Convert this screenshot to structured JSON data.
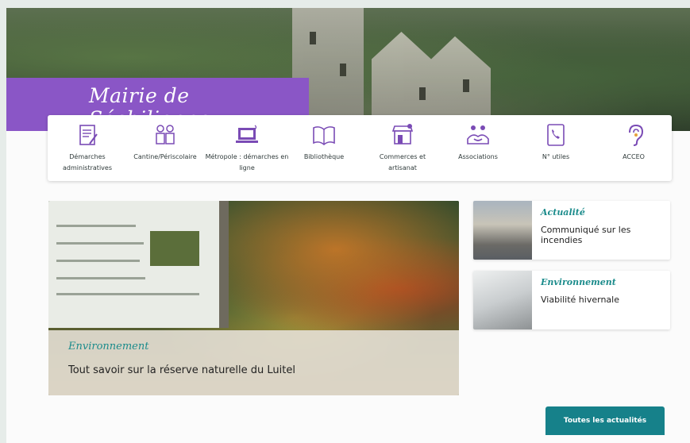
{
  "site": {
    "title": "Mairie de Séchilienne"
  },
  "quick_links": [
    {
      "label": "Démarches administratives",
      "icon": "document-icon"
    },
    {
      "label": "Cantine/Périscolaire",
      "icon": "children-icon"
    },
    {
      "label": "Métropole : démarches en ligne",
      "icon": "laptop-icon"
    },
    {
      "label": "Bibliothèque",
      "icon": "book-icon"
    },
    {
      "label": "Commerces et artisanat",
      "icon": "shop-icon"
    },
    {
      "label": "Associations",
      "icon": "handshake-icon"
    },
    {
      "label": "N° utiles",
      "icon": "phone-icon"
    },
    {
      "label": "ACCEO",
      "icon": "ear-icon"
    }
  ],
  "featured": {
    "category": "Environnement",
    "title": "Tout savoir sur la réserve naturelle du Luitel"
  },
  "news": [
    {
      "category": "Actualité",
      "title": "Communiqué sur les incendies"
    },
    {
      "category": "Environnement",
      "title": "Viabilité hivernale"
    }
  ],
  "actions": {
    "all_news": "Toutes les actualités"
  },
  "colors": {
    "brand_purple": "#8a56c6",
    "accent_teal": "#16818a",
    "icon_purple": "#7a4bb5"
  }
}
